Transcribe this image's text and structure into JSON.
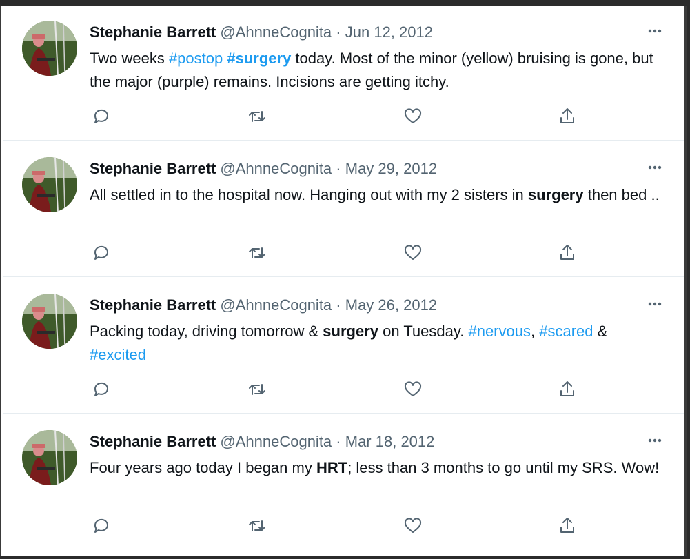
{
  "tweets": [
    {
      "name": "Stephanie Barrett",
      "handle": "@AhnneCognita",
      "separator": "·",
      "date": "Jun 12, 2012",
      "text": [
        {
          "t": "Two weeks ",
          "s": "plain"
        },
        {
          "t": "#postop",
          "s": "hashtag"
        },
        {
          "t": " ",
          "s": "plain"
        },
        {
          "t": "#surgery",
          "s": "hashtag-bold"
        },
        {
          "t": " today. Most of the minor (yellow) bruising is gone, but the major (purple) remains. Incisions are getting itchy.",
          "s": "plain"
        }
      ]
    },
    {
      "name": "Stephanie Barrett",
      "handle": "@AhnneCognita",
      "separator": "·",
      "date": "May 29, 2012",
      "text": [
        {
          "t": "All settled in to the hospital now. Hanging out with my 2 sisters in ",
          "s": "plain"
        },
        {
          "t": "surgery",
          "s": "bold"
        },
        {
          "t": " then bed ..",
          "s": "plain"
        }
      ]
    },
    {
      "name": "Stephanie Barrett",
      "handle": "@AhnneCognita",
      "separator": "·",
      "date": "May 26, 2012",
      "text": [
        {
          "t": "Packing today, driving tomorrow & ",
          "s": "plain"
        },
        {
          "t": "surgery",
          "s": "bold"
        },
        {
          "t": " on Tuesday. ",
          "s": "plain"
        },
        {
          "t": "#nervous",
          "s": "hashtag"
        },
        {
          "t": ", ",
          "s": "plain"
        },
        {
          "t": "#scared",
          "s": "hashtag"
        },
        {
          "t": " & ",
          "s": "plain"
        },
        {
          "t": "#excited",
          "s": "hashtag"
        }
      ]
    },
    {
      "name": "Stephanie Barrett",
      "handle": "@AhnneCognita",
      "separator": "·",
      "date": "Mar 18, 2012",
      "text": [
        {
          "t": "Four years ago today I began my ",
          "s": "plain"
        },
        {
          "t": "HRT",
          "s": "bold"
        },
        {
          "t": "; less than 3 months to go until my SRS. Wow!",
          "s": "plain"
        }
      ]
    }
  ],
  "icons": {
    "more": "more-icon",
    "reply": "reply-icon",
    "retweet": "retweet-icon",
    "like": "like-icon",
    "share": "share-icon"
  },
  "colors": {
    "hashtag": "#1d9bf0",
    "text": "#0f1419",
    "secondary": "#536471"
  }
}
